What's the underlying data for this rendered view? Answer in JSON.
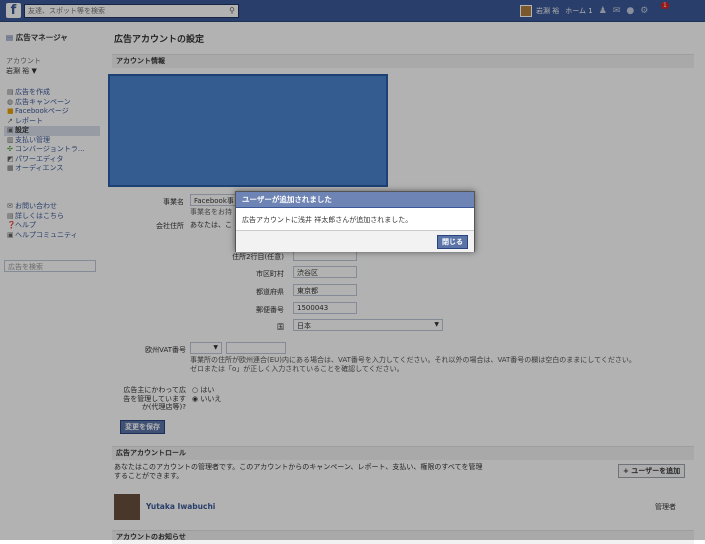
{
  "topbar": {
    "search_placeholder": "友達、スポット等を検索",
    "user_name": "岩淵 裕",
    "home_label": "ホーム",
    "home_count": "1",
    "notification_count": "1"
  },
  "left": {
    "title": "広告マネージャ",
    "account_label": "アカウント",
    "account_user": "岩淵 裕 ▼",
    "menu": [
      {
        "icon": "▤",
        "label": "広告を作成"
      },
      {
        "icon": "◍",
        "label": "広告キャンペーン"
      },
      {
        "icon": "■",
        "label": "Facebookページ"
      },
      {
        "icon": "↗",
        "label": "レポート"
      },
      {
        "icon": "▣",
        "label": "設定"
      },
      {
        "icon": "▥",
        "label": "支払い管理"
      },
      {
        "icon": "✣",
        "label": "コンバージョントラ..."
      },
      {
        "icon": "◩",
        "label": "パワーエディタ"
      },
      {
        "icon": "▦",
        "label": "オーディエンス"
      }
    ],
    "help_menu": [
      {
        "icon": "✉",
        "label": "お問い合わせ"
      },
      {
        "icon": "▤",
        "label": "詳しくはこちら"
      },
      {
        "icon": "❓",
        "label": "ヘルプ"
      },
      {
        "icon": "▣",
        "label": "ヘルプコミュニティ"
      }
    ],
    "ad_search_placeholder": "広告を検索"
  },
  "main": {
    "page_title": "広告アカウントの設定",
    "account_info_header": "アカウント情報",
    "business_name_label": "事業名",
    "business_name_value": "Facebook事",
    "business_name_note": "事業名をお持",
    "address_label": "会社住所",
    "address_note": "あなたは、こ",
    "address2_label": "住所2行目(任意)",
    "address2_value": "",
    "city_label": "市区町村",
    "city_value": "渋谷区",
    "prefecture_label": "都道府県",
    "prefecture_value": "東京都",
    "postal_label": "郵便番号",
    "postal_value": "1500043",
    "country_label": "国",
    "country_value": "日本",
    "vat_label": "欧州VAT番号",
    "vat_prefix": "",
    "vat_value": "",
    "vat_note_1": "事業所の住所が欧州連合(EU)内にある場合は、VAT番号を入力してください。それ以外の場合は、VAT番号の欄は空白のままにしてください。",
    "vat_note_2": "ゼロまたは「o」が正しく入力されていることを確認してください。",
    "agency_label_1": "広告主にかわって広",
    "agency_label_2": "告を管理しています",
    "agency_label_3": "か(代理店等)?",
    "agency_yes": "はい",
    "agency_no": "いいえ",
    "save_button": "変更を保存",
    "roles_header": "広告アカウントロール",
    "roles_text_1": "あなたはこのアカウントの管理者です。このアカウントからのキャンペーン、レポート、支払い、権限のすべてを管理",
    "roles_text_2": "することができます。",
    "add_user_button": "+ ユーザーを追加",
    "role_user_name": "Yutaka Iwabuchi",
    "role_user_role": "管理者",
    "next_section": "アカウントのお知らせ"
  },
  "dialog": {
    "title": "ユーザーが追加されました",
    "message": "広告アカウントに浅井 祥太郎さんが追加されました。",
    "close_button": "閉じる"
  }
}
